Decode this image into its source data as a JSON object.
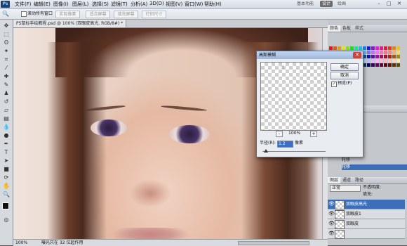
{
  "menubar": {
    "logo": "Ps",
    "items": [
      "文件(F)",
      "编辑(E)",
      "图像(I)",
      "图层(L)",
      "选择(S)",
      "滤镜(T)",
      "分析(A)",
      "3D(D)",
      "视图(V)",
      "窗口(W)",
      "帮助(H)"
    ],
    "workspaces": [
      "基本功能",
      "设计",
      "绘画"
    ],
    "active_workspace": "设计",
    "window_controls": [
      "–",
      "□",
      "✕"
    ]
  },
  "options": {
    "checkbox_label": "滚动所有窗口",
    "buttons": [
      "实际像素",
      "适合屏幕",
      "填充屏幕",
      "打印尺寸"
    ]
  },
  "document": {
    "tab_title": "PS鼠标手绘教程.psd @ 100% (双眼皮高光, RGB/8#) *",
    "zoom": "100%",
    "status": "曝光只在 32 位起作用"
  },
  "dialog": {
    "title": "高斯模糊",
    "ok": "确定",
    "cancel": "取消",
    "preview_label": "预览(P)",
    "preview_checked": true,
    "zoom": "100%",
    "zoom_out": "-",
    "zoom_in": "+",
    "radius_label": "半径(R):",
    "radius_value": "1.2",
    "radius_unit": "像素",
    "radius_slider_fraction": 0.06
  },
  "panels": {
    "color_tabs": [
      "颜色",
      "色板",
      "样式"
    ],
    "history_items": [
      "度度表纹",
      "轮移",
      "轮移"
    ],
    "layers_tabs": [
      "图层",
      "通道",
      "路径"
    ],
    "blend_mode": "正常",
    "opacity_label": "不透明度:",
    "fill_label": "填充:",
    "layers": [
      {
        "name": "双眼皮高光",
        "selected": true
      },
      {
        "name": "双眼皮1",
        "selected": false
      },
      {
        "name": "双眼皮",
        "selected": false
      },
      {
        "name": "",
        "selected": false
      }
    ]
  },
  "colors": {
    "accent": "#3d6fb8",
    "dialog_title": "#9bb5dc",
    "close": "#c9463d"
  }
}
